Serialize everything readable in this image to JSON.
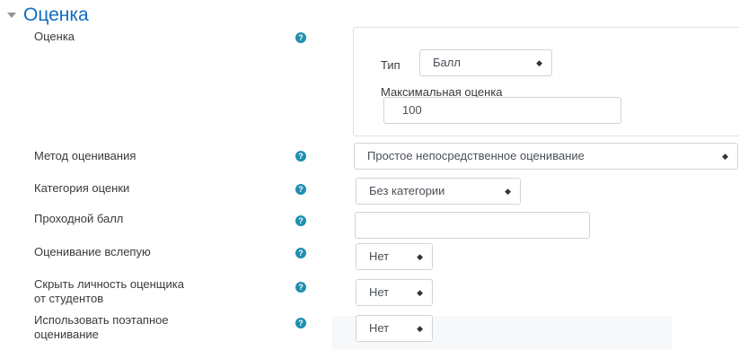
{
  "section": {
    "title": "Оценка"
  },
  "grade": {
    "label": "Оценка",
    "type_label": "Тип",
    "type_value": "Балл",
    "max_label": "Максимальная оценка",
    "max_value": "100"
  },
  "grading_method": {
    "label": "Метод оценивания",
    "value": "Простое непосредственное оценивание"
  },
  "grade_category": {
    "label": "Категория оценки",
    "value": "Без категории"
  },
  "pass_grade": {
    "label": "Проходной балл",
    "value": ""
  },
  "blind_marking": {
    "label": "Оценивание вслепую",
    "value": "Нет"
  },
  "hide_grader": {
    "label_line1": "Скрыть личность оценщика",
    "label_line2": "от студентов",
    "value": "Нет"
  },
  "marking_workflow": {
    "label_line1": "Использовать поэтапное",
    "label_line2": "оценивание",
    "value": "Нет"
  },
  "icons": {
    "help": "question-circle-icon",
    "caret": "select-caret-icon",
    "collapse": "triangle-down-icon"
  },
  "colors": {
    "accent": "#0f6cbf",
    "help_icon": "#1f8fb0",
    "text": "#373a3c",
    "border": "#ced4da"
  },
  "help_glyph": "?",
  "caret_glyph": "◆"
}
